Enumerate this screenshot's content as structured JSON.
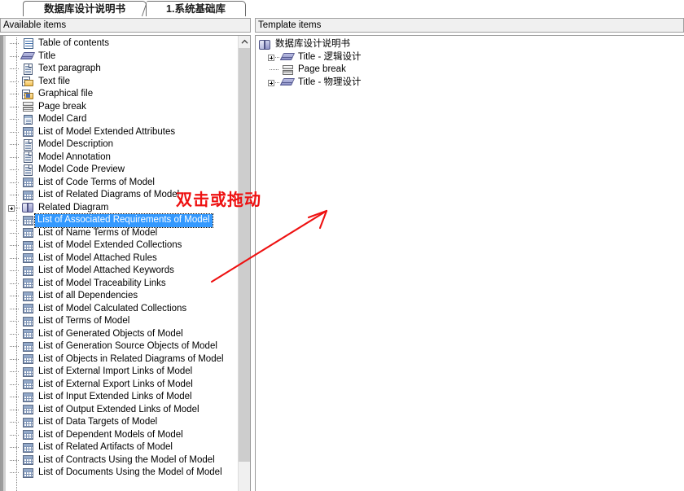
{
  "tabs": [
    {
      "label": "数据库设计说明书",
      "active": true,
      "name": "tab-db-design-spec"
    },
    {
      "label": "1.系统基础库",
      "active": false,
      "name": "tab-system-base-lib"
    }
  ],
  "left_panel": {
    "header": "Available items",
    "scrollbar": {
      "up_arrow": "▲"
    },
    "items": [
      {
        "label": "Table of contents",
        "icon": "toc-icon",
        "expandable": false
      },
      {
        "label": "Title",
        "icon": "title-icon",
        "expandable": false
      },
      {
        "label": "Text paragraph",
        "icon": "document-icon",
        "expandable": false
      },
      {
        "label": "Text file",
        "icon": "text-file-icon",
        "expandable": false
      },
      {
        "label": "Graphical file",
        "icon": "graphical-file-icon",
        "expandable": false
      },
      {
        "label": "Page break",
        "icon": "page-break-icon",
        "expandable": false
      },
      {
        "label": "Model Card",
        "icon": "model-card-icon",
        "expandable": false
      },
      {
        "label": "List of Model Extended Attributes",
        "icon": "list-grid-icon",
        "expandable": false
      },
      {
        "label": "Model Description",
        "icon": "document-icon",
        "expandable": false
      },
      {
        "label": "Model Annotation",
        "icon": "document-icon",
        "expandable": false
      },
      {
        "label": "Model Code Preview",
        "icon": "document-icon",
        "expandable": false
      },
      {
        "label": "List of Code Terms of Model",
        "icon": "list-grid-icon",
        "expandable": false
      },
      {
        "label": "List of Related Diagrams of Model",
        "icon": "list-grid-icon",
        "expandable": false
      },
      {
        "label": "Related Diagram",
        "icon": "related-diagram-icon",
        "expandable": true
      },
      {
        "label": "List of Associated Requirements of Model",
        "icon": "list-grid-icon",
        "expandable": false,
        "selected": true
      },
      {
        "label": "List of Name Terms of Model",
        "icon": "list-grid-icon",
        "expandable": false
      },
      {
        "label": "List of Model Extended Collections",
        "icon": "list-grid-icon",
        "expandable": false
      },
      {
        "label": "List of Model Attached Rules",
        "icon": "list-grid-icon",
        "expandable": false
      },
      {
        "label": "List of Model Attached Keywords",
        "icon": "list-grid-icon",
        "expandable": false
      },
      {
        "label": "List of Model Traceability Links",
        "icon": "list-grid-icon",
        "expandable": false
      },
      {
        "label": "List of all Dependencies",
        "icon": "list-grid-icon",
        "expandable": false
      },
      {
        "label": "List of Model Calculated Collections",
        "icon": "list-grid-icon",
        "expandable": false
      },
      {
        "label": "List of Terms of Model",
        "icon": "list-grid-icon",
        "expandable": false
      },
      {
        "label": "List of Generated Objects of Model",
        "icon": "list-grid-icon",
        "expandable": false
      },
      {
        "label": "List of Generation Source Objects of Model",
        "icon": "list-grid-icon",
        "expandable": false
      },
      {
        "label": "List of Objects in Related Diagrams of Model",
        "icon": "list-grid-icon",
        "expandable": false
      },
      {
        "label": "List of External Import Links of Model",
        "icon": "list-grid-icon",
        "expandable": false
      },
      {
        "label": "List of External Export Links of Model",
        "icon": "list-grid-icon",
        "expandable": false
      },
      {
        "label": "List of Input Extended Links of Model",
        "icon": "list-grid-icon",
        "expandable": false
      },
      {
        "label": "List of Output Extended Links of Model",
        "icon": "list-grid-icon",
        "expandable": false
      },
      {
        "label": "List of Data Targets of Model",
        "icon": "list-grid-icon",
        "expandable": false
      },
      {
        "label": "List of Dependent Models of Model",
        "icon": "list-grid-icon",
        "expandable": false
      },
      {
        "label": "List of Related Artifacts of Model",
        "icon": "list-grid-icon",
        "expandable": false
      },
      {
        "label": "List of Contracts Using the Model of Model",
        "icon": "list-grid-icon",
        "expandable": false
      },
      {
        "label": "List of Documents Using the Model of Model",
        "icon": "list-grid-icon",
        "expandable": false
      }
    ]
  },
  "right_panel": {
    "header": "Template items",
    "items": [
      {
        "label": "数据库设计说明书",
        "icon": "related-diagram-icon",
        "expandable": false,
        "level": 0
      },
      {
        "label": "Title - 逻辑设计",
        "icon": "title-icon",
        "expandable": true,
        "level": 1
      },
      {
        "label": "Page break",
        "icon": "page-break-icon",
        "expandable": false,
        "level": 1
      },
      {
        "label": "Title - 物理设计",
        "icon": "title-icon",
        "expandable": true,
        "level": 1
      }
    ]
  },
  "annotation": {
    "text": "双击或拖动",
    "color": "#ee1111",
    "arrow": "diagonal-arrow-up-right"
  },
  "colors": {
    "selection_bg": "#3399ff",
    "selection_fg": "#ffffff",
    "panel_header_bg": "#f0f0f0",
    "panel_border": "#9a9a9a",
    "annotation_red": "#ee1111",
    "scroll_thumb": "#cdcdcd"
  }
}
